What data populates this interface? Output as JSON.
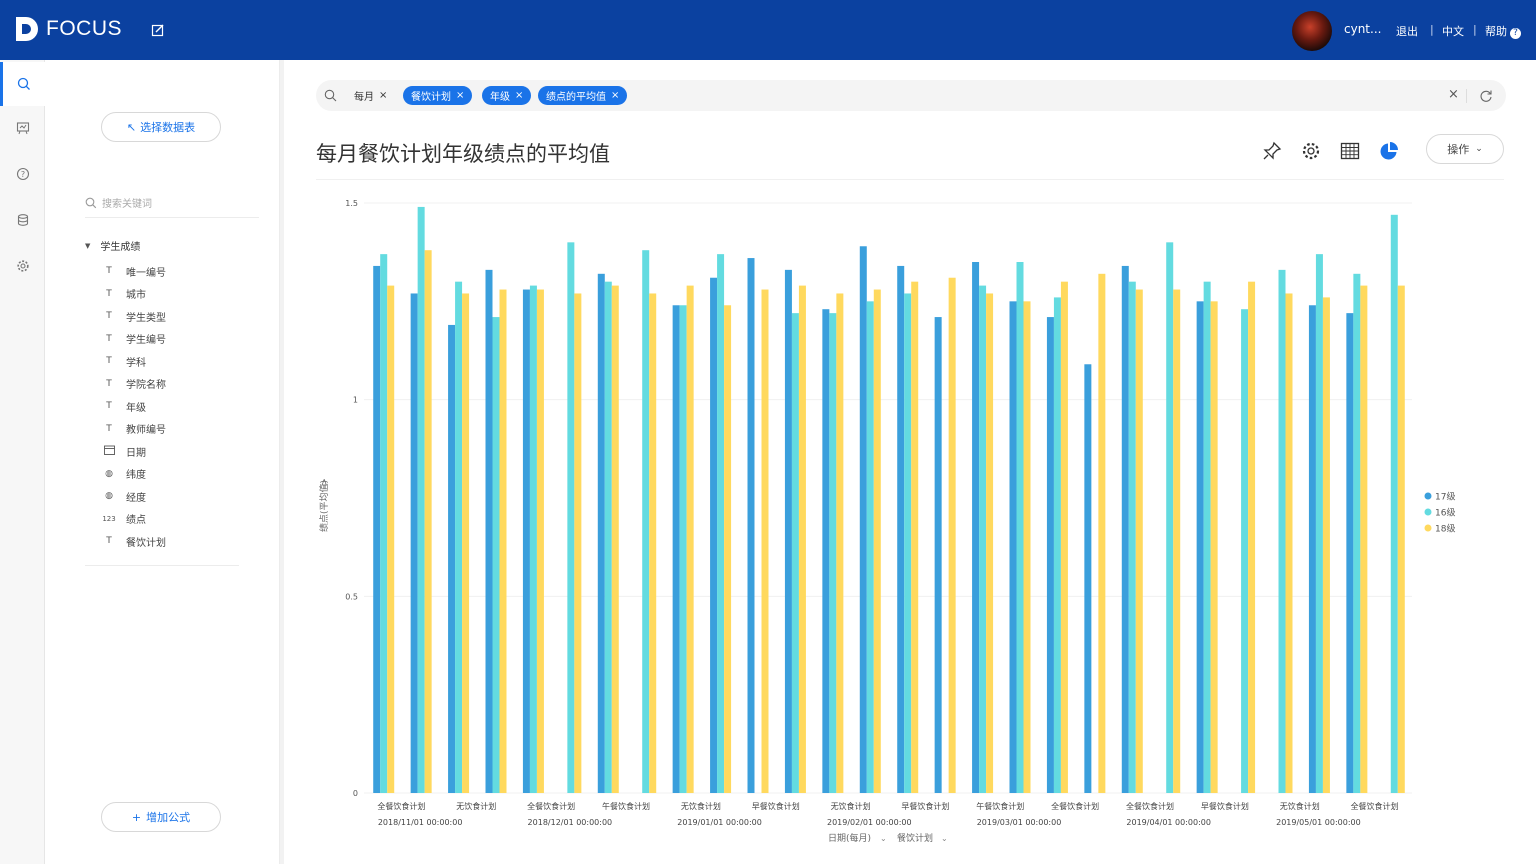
{
  "app": {
    "title": "FOCUS",
    "user": "cynt...",
    "links": [
      "退出",
      "中文",
      "帮助"
    ]
  },
  "sidebar": {
    "select_table": "选择数据表",
    "search_placeholder": "搜索关键词",
    "table_name": "学生成绩",
    "fields": [
      {
        "icon": "T",
        "label": "唯一编号"
      },
      {
        "icon": "T",
        "label": "城市"
      },
      {
        "icon": "T",
        "label": "学生类型"
      },
      {
        "icon": "T",
        "label": "学生编号"
      },
      {
        "icon": "T",
        "label": "学科"
      },
      {
        "icon": "T",
        "label": "学院名称"
      },
      {
        "icon": "T",
        "label": "年级"
      },
      {
        "icon": "T",
        "label": "教师编号"
      },
      {
        "icon": "date",
        "label": "日期"
      },
      {
        "icon": "geo",
        "label": "纬度"
      },
      {
        "icon": "geo",
        "label": "经度"
      },
      {
        "icon": "123",
        "label": "绩点"
      },
      {
        "icon": "T",
        "label": "餐饮计划"
      }
    ],
    "add_formula": "增加公式"
  },
  "search": {
    "tokens": [
      {
        "label": "每月",
        "style": "plain"
      },
      {
        "label": "餐饮计划",
        "style": "blue"
      },
      {
        "label": "年级",
        "style": "blue"
      },
      {
        "label": "绩点的平均值",
        "style": "blue"
      }
    ]
  },
  "header": {
    "title": "每月餐饮计划年级绩点的平均值",
    "operate": "操作"
  },
  "colors": {
    "s17": "#3a9fdc",
    "s16": "#63dbe0",
    "s18": "#ffd95e",
    "topbar": "#0b41a0",
    "accent": "#1a73e8"
  },
  "chart_data": {
    "type": "bar",
    "ylabel": "绩点(平均值)",
    "ylim": [
      0,
      1.5
    ],
    "yticks": [
      "0",
      "0.5",
      "1",
      "1.5"
    ],
    "xlabel_parts": [
      "日期(每月)",
      "餐饮计划"
    ],
    "legend": [
      "17级",
      "16级",
      "18级"
    ],
    "category_labels": [
      "全餐饮食计划",
      "无饮食计划",
      "全餐饮食计划",
      "午餐饮食计划",
      "无饮食计划",
      "早餐饮食计划",
      "无饮食计划",
      "早餐饮食计划",
      "午餐饮食计划",
      "全餐饮食计划",
      "全餐饮食计划",
      "早餐饮食计划",
      "无饮食计划",
      "全餐饮食计划"
    ],
    "date_labels": [
      "2018/11/01 00:00:00",
      "2018/12/01 00:00:00",
      "2019/01/01 00:00:00",
      "2019/02/01 00:00:00",
      "2019/03/01 00:00:00",
      "2019/04/01 00:00:00",
      "2019/05/01 00:00:00"
    ],
    "series": [
      {
        "name": "17级",
        "values": [
          1.34,
          1.27,
          1.19,
          1.33,
          1.28,
          null,
          1.32,
          null,
          1.24,
          1.31,
          1.36,
          1.33,
          1.23,
          1.39,
          1.34,
          1.21,
          1.35,
          1.25,
          1.21,
          1.09,
          1.34,
          null,
          1.25,
          null,
          null,
          1.24,
          1.22,
          null
        ]
      },
      {
        "name": "16级",
        "values": [
          1.37,
          1.49,
          1.3,
          1.21,
          1.29,
          1.4,
          1.3,
          1.38,
          1.24,
          1.37,
          null,
          1.22,
          1.22,
          1.25,
          1.27,
          null,
          1.29,
          1.35,
          1.26,
          null,
          1.3,
          1.4,
          1.3,
          1.23,
          1.33,
          1.37,
          1.32,
          1.47
        ]
      },
      {
        "name": "18级",
        "values": [
          1.29,
          1.38,
          1.27,
          1.28,
          1.28,
          1.27,
          1.29,
          1.27,
          1.29,
          1.24,
          1.28,
          1.29,
          1.27,
          1.28,
          1.3,
          1.31,
          1.27,
          1.25,
          1.3,
          1.32,
          1.28,
          1.28,
          1.25,
          1.3,
          1.27,
          1.26,
          1.29,
          1.29
        ]
      }
    ]
  }
}
